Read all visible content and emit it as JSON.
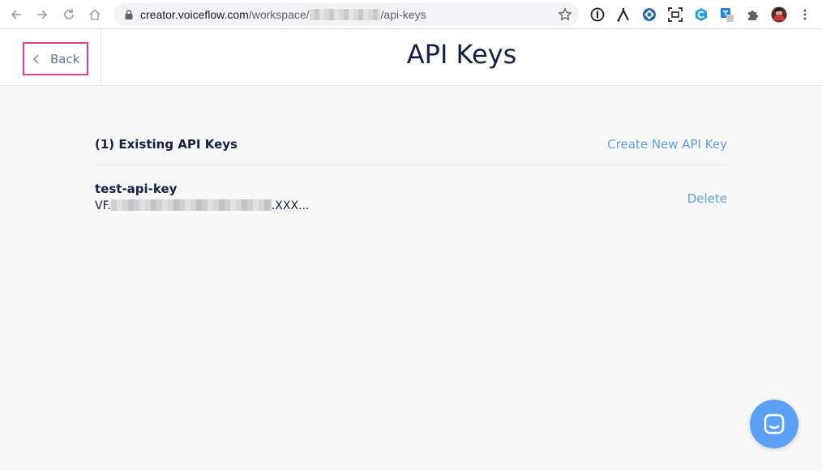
{
  "browser": {
    "url_host": "creator.voiceflow.com",
    "url_path_prefix": "/workspace/",
    "url_path_suffix": "/api-keys"
  },
  "header": {
    "back_label": "Back",
    "title": "API Keys"
  },
  "keys_section": {
    "count_label": "(1) Existing API Keys",
    "create_label": "Create New API Key",
    "keys": [
      {
        "name": "test-api-key",
        "value_prefix": "VF.",
        "value_suffix": ".XXX...",
        "delete_label": "Delete"
      }
    ]
  },
  "colors": {
    "accent": "#5d9df5",
    "highlight_border": "#e83e8c",
    "title": "#132144",
    "chat_bubble": "#5aa0f5"
  },
  "icons": {
    "browser": [
      "back-arrow-icon",
      "forward-arrow-icon",
      "reload-icon",
      "home-icon",
      "lock-icon",
      "star-icon"
    ],
    "extensions": [
      "info-icon",
      "fork-icon",
      "blue-circle-extension-icon",
      "screenshot-icon",
      "hexagon-extension-icon",
      "translate-extension-icon",
      "puzzle-icon",
      "avatar",
      "kebab-menu-icon"
    ],
    "app": [
      "chevron-left-icon",
      "chat-icon"
    ]
  }
}
